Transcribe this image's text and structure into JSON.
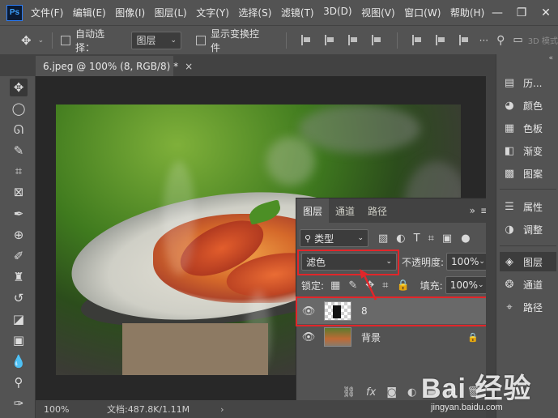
{
  "app": {
    "logo": "Ps"
  },
  "menu": [
    "文件(F)",
    "编辑(E)",
    "图像(I)",
    "图层(L)",
    "文字(Y)",
    "选择(S)",
    "滤镜(T)",
    "3D(D)",
    "视图(V)",
    "窗口(W)",
    "帮助(H)"
  ],
  "window_controls": {
    "minimize": "—",
    "restore": "❐",
    "close": "✕"
  },
  "options": {
    "move_icon": "✥",
    "auto_select_label": "自动选择：",
    "target_value": "图层",
    "show_transform_label": "显示变换控件",
    "mode_3d": "3D 模式"
  },
  "document": {
    "tab_title": "6.jpeg @ 100% (8, RGB/8) *",
    "close": "×"
  },
  "tools": [
    {
      "name": "move-tool",
      "glyph": "✥"
    },
    {
      "name": "marquee-tool",
      "glyph": "◯"
    },
    {
      "name": "lasso-tool",
      "glyph": "ᘏ"
    },
    {
      "name": "quick-select-tool",
      "glyph": "✎"
    },
    {
      "name": "crop-tool",
      "glyph": "⌗"
    },
    {
      "name": "frame-tool",
      "glyph": "⊠"
    },
    {
      "name": "eyedropper-tool",
      "glyph": "✒"
    },
    {
      "name": "spot-heal-tool",
      "glyph": "⊕"
    },
    {
      "name": "brush-tool",
      "glyph": "✐"
    },
    {
      "name": "clone-stamp-tool",
      "glyph": "♜"
    },
    {
      "name": "history-brush-tool",
      "glyph": "↺"
    },
    {
      "name": "eraser-tool",
      "glyph": "◪"
    },
    {
      "name": "gradient-tool",
      "glyph": "▣"
    },
    {
      "name": "blur-tool",
      "glyph": "💧"
    },
    {
      "name": "dodge-tool",
      "glyph": "⚲"
    },
    {
      "name": "pen-tool",
      "glyph": "✑"
    }
  ],
  "layers_panel": {
    "tabs": [
      "图层",
      "通道",
      "路径"
    ],
    "kind_filter": "类型",
    "blend_mode": "滤色",
    "opacity_label": "不透明度:",
    "opacity_value": "100%",
    "lock_label": "锁定:",
    "fill_label": "填充:",
    "fill_value": "100%",
    "layers": [
      {
        "name": "8",
        "visible": true,
        "selected": true
      },
      {
        "name": "背景",
        "visible": true,
        "locked": true
      }
    ],
    "footer_icons": [
      "link-icon",
      "fx-icon",
      "mask-icon",
      "adjustment-icon",
      "folder-icon",
      "new-layer-icon",
      "trash-icon"
    ]
  },
  "dock": [
    {
      "label": "历...",
      "icon": "history-icon"
    },
    {
      "label": "颜色",
      "icon": "palette-icon"
    },
    {
      "label": "色板",
      "icon": "swatches-icon"
    },
    {
      "label": "渐变",
      "icon": "gradient-icon"
    },
    {
      "label": "图案",
      "icon": "pattern-icon"
    },
    {
      "label": "属性",
      "icon": "properties-icon"
    },
    {
      "label": "调整",
      "icon": "adjustments-icon"
    },
    {
      "label": "图层",
      "icon": "layers-icon"
    },
    {
      "label": "通道",
      "icon": "channels-icon"
    },
    {
      "label": "路径",
      "icon": "paths-icon"
    }
  ],
  "status": {
    "zoom": "100%",
    "doc_info": "文档:487.8K/1.11M",
    "arrow": "›"
  },
  "watermark": {
    "logo": "Bai 经验",
    "url": "jingyan.baidu.com"
  },
  "colors": {
    "highlight": "#e1262a",
    "panel": "#535353",
    "dark": "#424242"
  }
}
